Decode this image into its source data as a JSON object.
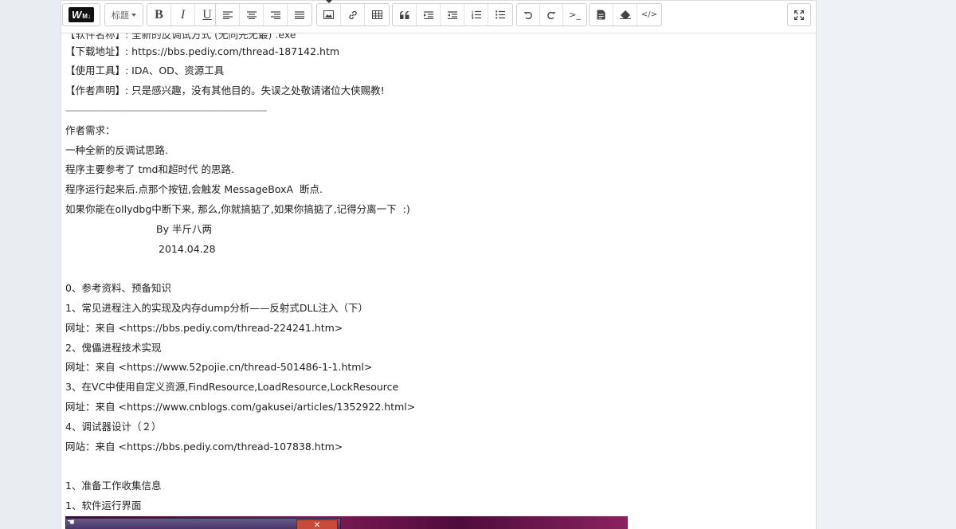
{
  "toolbar": {
    "logo_text": "W",
    "logo_suffix": "M↓",
    "heading_label": "标题",
    "buttons": {
      "bold": "B",
      "italic": "I",
      "underline": "U",
      "code": ">_",
      "html": "</>"
    }
  },
  "content": {
    "clipped_line": "【软件名称】: 全新的反调试方式 (无同先无最) .exe",
    "download": "【下载地址】: https://bbs.pediy.com/thread-187142.htm",
    "tools": "【使用工具】: IDA、OD、资源工具",
    "statement": "【作者声明】: 只是感兴趣，没有其他目的。失误之处敬请诸位大侠赐教!",
    "separator": "-------------------------------------------------------------------------------------",
    "req_title": "作者需求：",
    "req1": "一种全新的反调试思路.",
    "req2": "程序主要参考了 tmd和超时代 的思路.",
    "req3": "程序运行起来后.点那个按钮,会触发 MessageBoxA  断点.",
    "req4": "如果你能在ollydbg中断下来, 那么,你就搞掂了,如果你搞掂了,记得分离一下  :)",
    "by": "By 半斤八两",
    "date": "2014.04.28",
    "ref_title": "0、参考资料、预备知识",
    "ref1": "1、常见进程注入的实现及内存dump分析——反射式DLL注入（下）",
    "ref1_url": "网址：来自 <https://bbs.pediy.com/thread-224241.htm>",
    "ref2": "2、傀儡进程技术实现",
    "ref2_url": "网址：来自 <https://www.52pojie.cn/thread-501486-1-1.html>",
    "ref3": "3、在VC中使用自定义资源,FindResource,LoadResource,LockResource",
    "ref3_url": "网址：来自 <https://www.cnblogs.com/gakusei/articles/1352922.html>",
    "ref4": "4、调试器设计（２）",
    "ref4_url": "网站：来自 <https://bbs.pediy.com/thread-107838.htm>",
    "prep_title": "1、准备工作收集信息",
    "prep1": "1、软件运行界面"
  }
}
